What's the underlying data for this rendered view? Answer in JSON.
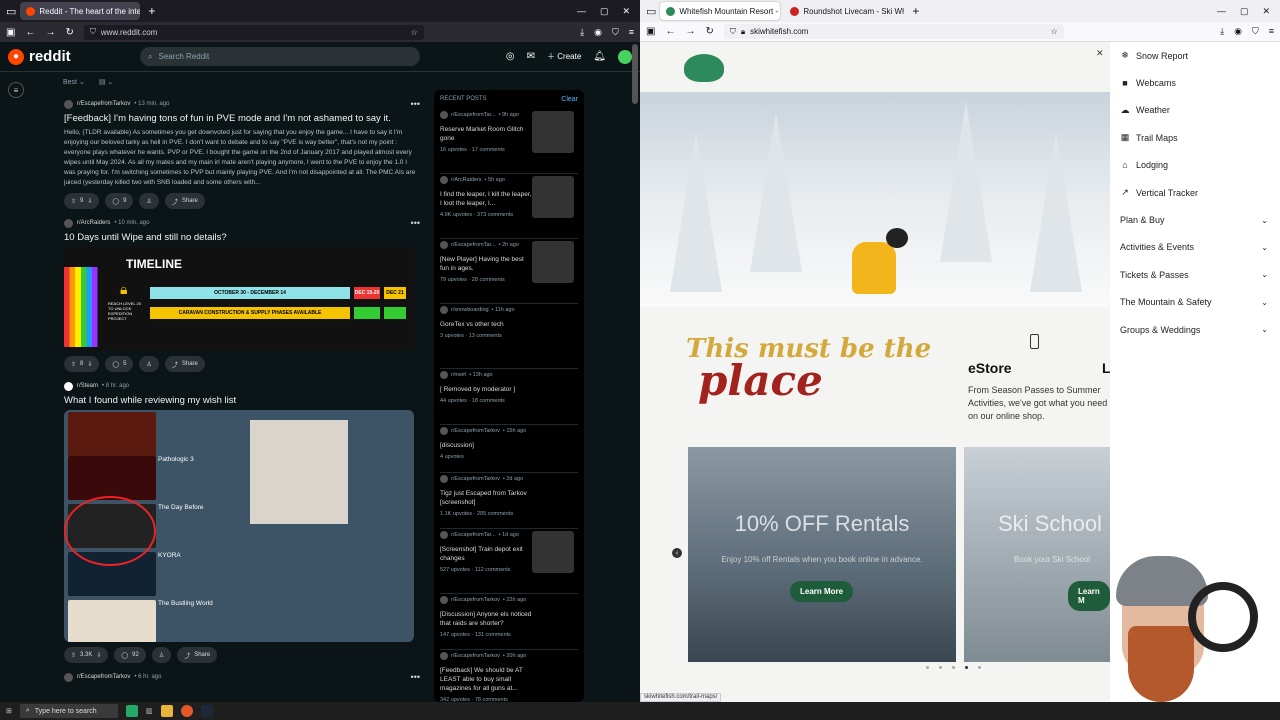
{
  "left_browser": {
    "tabs": [
      {
        "title": "Reddit - The heart of the intern"
      }
    ],
    "url": "www.reddit.com",
    "reddit": {
      "logo_text": "reddit",
      "search_placeholder": "Search Reddit",
      "create_label": "Create",
      "sort_label": "Best",
      "posts": [
        {
          "subreddit": "r/EscapefromTarkov",
          "time": "• 13 min. ago",
          "title": "[Feedback] I'm having tons of fun in PVE mode and I'm not ashamed to say it.",
          "body": "Hello, (TLDR available) As sometimes you get downvoted just for saying that you enjoy the game... I have to say it I'm enjoying our beloved tarky as hell in PVE. I don't want to debate and to say \"PVE is way better\", that's not my point : everyone plays whatever he wants. PVP or PVE. I bought the game on the 2nd of January 2017 and played almost every wipes until May 2024. As all my mates and my main irl mate aren't playing anymore, I went to the PVE to enjoy the 1.0 I was praying for. I'm switching sometimes to PVP but mainly playing PVE. And I'm not disappointed at all. The PMC AIs are juiced (yesterday killed two with SNB loaded and some others with...",
          "votes": "9",
          "comments": "9",
          "share": "Share"
        },
        {
          "subreddit": "r/ArcRaiders",
          "time": "• 10 min. ago",
          "title": "10 Days until Wipe and still no details?",
          "votes": "8",
          "comments": "5",
          "share": "Share",
          "image": {
            "heading": "TIMELINE",
            "date_range": "OCTOBER 30 - DECEMBER 14",
            "d1": "DEC 15-20",
            "d2": "DEC 21",
            "phase": "CARAVAN CONSTRUCTION & SUPPLY PHASES AVAILABLE",
            "reach": "REACH LEVEL 20 TO UNLOCK EXPEDITION PROJECT"
          }
        },
        {
          "subreddit": "r/Steam",
          "time": "• 8 hr. ago",
          "title": "What I found while reviewing my wish list",
          "votes": "3.3K",
          "comments": "92",
          "share": "Share",
          "games": [
            "Pathologic 3",
            "The Day Before",
            "KYORA",
            "The Bustling World"
          ]
        },
        {
          "subreddit": "r/EscapefromTarkov",
          "time": "• 6 hr. ago"
        }
      ],
      "recent": {
        "header": "RECENT POSTS",
        "clear": "Clear",
        "items": [
          {
            "sub": "r/EscapefromTar...",
            "time": "• 9h ago",
            "title": "Reserve Market Room Glitch gone",
            "stats": "16 upvotes · 17 comments"
          },
          {
            "sub": "r/ArcRaiders",
            "time": "• 5h ago",
            "title": "I find the leaper, I kill the leaper, I loot the leaper, I...",
            "stats": "4.9K upvotes · 373 comments"
          },
          {
            "sub": "r/EscapefromTar...",
            "time": "• 2h ago",
            "title": "[New Player] Having the best fun in ages.",
            "stats": "79 upvotes · 28 comments"
          },
          {
            "sub": "r/snowboarding",
            "time": "• 11h ago",
            "title": "GoreTex vs other tech",
            "stats": "3 upvotes · 13 comments"
          },
          {
            "sub": "r/meirl",
            "time": "• 13h ago",
            "title": "[ Removed by moderator ]",
            "stats": "44 upvotes · 18 comments"
          },
          {
            "sub": "r/EscapefromTarkov",
            "time": "• 15h ago",
            "title": "[discussion]",
            "stats": "4 upvotes"
          },
          {
            "sub": "r/EscapefromTarkov",
            "time": "• 2d ago",
            "title": "Tigz just Escaped from Tarkov [screenshot]",
            "stats": "1.1K upvotes · 205 comments"
          },
          {
            "sub": "r/EscapefromTar...",
            "time": "• 1d ago",
            "title": "[Screenshot] Train depot exit changes",
            "stats": "527 upvotes · 112 comments"
          },
          {
            "sub": "r/EscapefromTarkov",
            "time": "• 22h ago",
            "title": "[Discussion] Anyone els noticed that raids are shorter?",
            "stats": "147 upvotes · 131 comments"
          },
          {
            "sub": "r/EscapefromTarkov",
            "time": "• 20h ago",
            "title": "[Feedback] We should be AT LEAST able to buy small magazines for all guns at...",
            "stats": "342 upvotes · 78 comments"
          }
        ]
      }
    }
  },
  "right_browser": {
    "tabs": [
      {
        "title": "Whitefish Mountain Resort - Se"
      },
      {
        "title": "Roundshot Livecam - Ski White"
      }
    ],
    "url": "skiwhitefish.com",
    "status_url": "skiwhitefish.com/trail-maps/",
    "tagline_line1": "This must be the",
    "tagline_line2": "place",
    "estore": {
      "title": "eStore",
      "text": "From Season Passes to Summer Activities, we've got what you need on our online shop.",
      "cut_letter": "L"
    },
    "cards": [
      {
        "title": "10% OFF Rentals",
        "subtitle": "Enjoy 10% off Rentals when you book online in advance.",
        "button": "Learn More"
      },
      {
        "title": "Ski School",
        "subtitle": "Book your Ski School",
        "button": "Learn M"
      }
    ],
    "menu": [
      {
        "label": "Snow Report",
        "icon": "snowflake-icon"
      },
      {
        "label": "Webcams",
        "icon": "camera-icon"
      },
      {
        "label": "Weather",
        "icon": "weather-icon"
      },
      {
        "label": "Trail Maps",
        "icon": "map-icon"
      },
      {
        "label": "Lodging",
        "icon": "lodging-icon"
      },
      {
        "label": "Vertical Tracker",
        "icon": "chart-icon"
      },
      {
        "label": "Plan & Buy"
      },
      {
        "label": "Activities & Events"
      },
      {
        "label": "Tickets & Passes"
      },
      {
        "label": "The Mountain & Safety"
      },
      {
        "label": "Groups & Weddings"
      }
    ]
  },
  "taskbar": {
    "search_placeholder": "Type here to search"
  }
}
